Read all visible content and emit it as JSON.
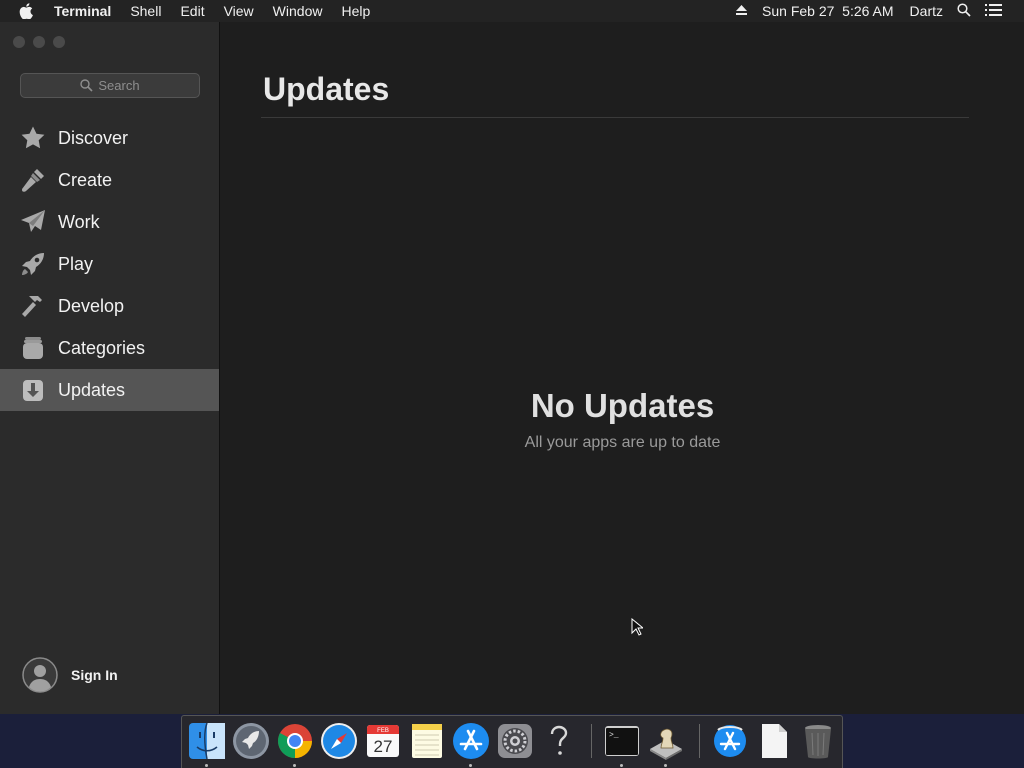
{
  "menubar": {
    "app_name": "Terminal",
    "items": [
      "Shell",
      "Edit",
      "View",
      "Window",
      "Help"
    ],
    "clock": "Sun Feb 27  5:26 AM",
    "user": "Dartz"
  },
  "sidebar": {
    "search_placeholder": "Search",
    "items": [
      {
        "label": "Discover",
        "icon": "star-icon"
      },
      {
        "label": "Create",
        "icon": "brush-icon"
      },
      {
        "label": "Work",
        "icon": "paper-plane-icon"
      },
      {
        "label": "Play",
        "icon": "rocket-icon"
      },
      {
        "label": "Develop",
        "icon": "hammer-icon"
      },
      {
        "label": "Categories",
        "icon": "stack-icon"
      },
      {
        "label": "Updates",
        "icon": "download-icon",
        "selected": true
      }
    ],
    "sign_in": "Sign In"
  },
  "main": {
    "title": "Updates",
    "empty_title": "No Updates",
    "empty_subtitle": "All your apps are up to date"
  },
  "dock": {
    "calendar_month": "FEB",
    "calendar_day": "27",
    "terminal_prompt": ">_"
  },
  "colors": {
    "sidebar_bg": "#2b2b2b",
    "main_bg": "#1e1e1e",
    "selected_bg": "#555555",
    "menubar_bg": "#232323"
  }
}
